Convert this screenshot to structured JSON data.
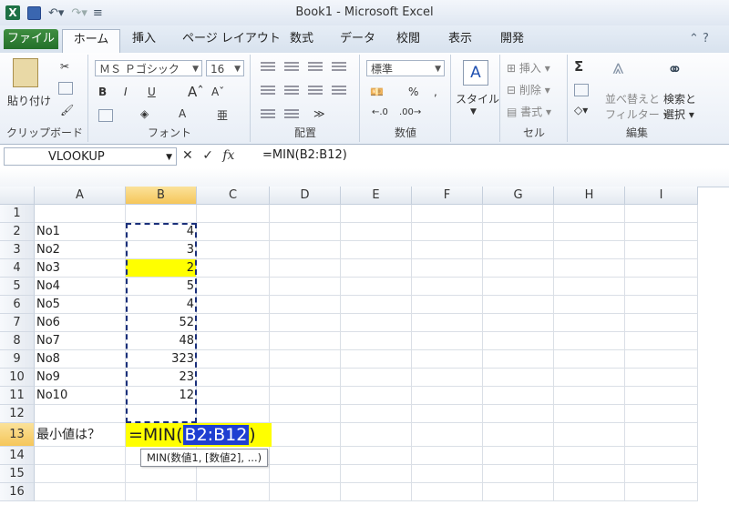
{
  "window": {
    "title": "Book1 - Microsoft Excel"
  },
  "tabs": [
    "ファイル",
    "ホーム",
    "挿入",
    "ページ レイアウト",
    "数式",
    "データ",
    "校閲",
    "表示",
    "開発"
  ],
  "ribbon": {
    "clipboard": {
      "paste_label": "貼り付け",
      "group_label": "クリップボード"
    },
    "font": {
      "font_name": "ＭＳ Ｐゴシック",
      "font_size": "16",
      "group_label": "フォント",
      "bold": "B",
      "italic": "I",
      "underline": "U"
    },
    "alignment": {
      "group_label": "配置"
    },
    "number": {
      "format": "標準",
      "group_label": "数値",
      "percent": "%",
      "comma": ","
    },
    "style": {
      "style_label": "スタイル"
    },
    "cells": {
      "insert": "挿入",
      "delete": "削除",
      "format": "書式",
      "group_label": "セル"
    },
    "editing": {
      "sigma": "Σ",
      "sort_label": "並べ替えと",
      "sort_label2": "フィルター",
      "find_label": "検索と",
      "find_label2": "選択",
      "group_label": "編集"
    }
  },
  "formula_bar": {
    "name_box": "VLOOKUP",
    "formula": "=MIN(B2:B12)",
    "fx": "fx"
  },
  "columns": [
    "A",
    "B",
    "C",
    "D",
    "E",
    "F",
    "G",
    "H",
    "I"
  ],
  "rows": [
    "1",
    "2",
    "3",
    "4",
    "5",
    "6",
    "7",
    "8",
    "9",
    "10",
    "11",
    "12",
    "13",
    "14",
    "15",
    "16"
  ],
  "data": [
    {
      "label": "No1",
      "value": "4"
    },
    {
      "label": "No2",
      "value": "3"
    },
    {
      "label": "No3",
      "value": "2"
    },
    {
      "label": "No4",
      "value": "5"
    },
    {
      "label": "No5",
      "value": "4"
    },
    {
      "label": "No6",
      "value": "52"
    },
    {
      "label": "No7",
      "value": "48"
    },
    {
      "label": "No8",
      "value": "323"
    },
    {
      "label": "No9",
      "value": "23"
    },
    {
      "label": "No10",
      "value": "12"
    }
  ],
  "question_label": "最小値は？",
  "edit": {
    "prefix": "=MIN(",
    "ref": "B2:B12",
    "suffix": ")"
  },
  "tooltip": "MIN(数値1, [数値2], ...)",
  "colors": {
    "highlight": "#ffff00",
    "file_tab": "#2e7d32",
    "ref_highlight": "#1f3fd1"
  }
}
